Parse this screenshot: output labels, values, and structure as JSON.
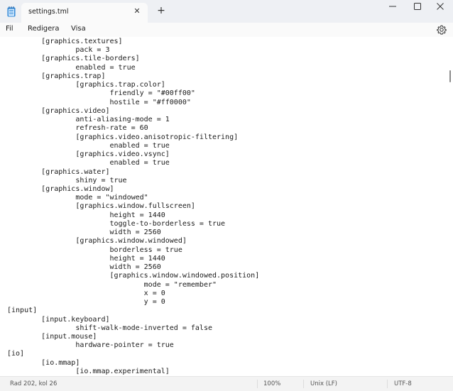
{
  "window": {
    "tab_title": "settings.tml",
    "tab_close": "✕",
    "new_tab": "+"
  },
  "menu": {
    "items": [
      "Fil",
      "Redigera",
      "Visa"
    ]
  },
  "editor": {
    "lines": [
      "        [graphics.textures]",
      "                pack = 3",
      "        [graphics.tile-borders]",
      "                enabled = true",
      "        [graphics.trap]",
      "                [graphics.trap.color]",
      "                        friendly = \"#00ff00\"",
      "                        hostile = \"#ff0000\"",
      "        [graphics.video]",
      "                anti-aliasing-mode = 1",
      "                refresh-rate = 60",
      "                [graphics.video.anisotropic-filtering]",
      "                        enabled = true",
      "                [graphics.video.vsync]",
      "                        enabled = true",
      "        [graphics.water]",
      "                shiny = true",
      "        [graphics.window]",
      "                mode = \"windowed\"",
      "                [graphics.window.fullscreen]",
      "                        height = 1440",
      "                        toggle-to-borderless = true",
      "                        width = 2560",
      "                [graphics.window.windowed]",
      "                        borderless = true",
      "                        height = 1440",
      "                        width = 2560",
      "                        [graphics.window.windowed.position]",
      "                                mode = \"remember\"",
      "                                x = 0",
      "                                y = 0",
      "[input]",
      "        [input.keyboard]",
      "                shift-walk-mode-inverted = false",
      "        [input.mouse]",
      "                hardware-pointer = true",
      "[io]",
      "        [io.mmap]",
      "                [io.mmap.experimental]"
    ]
  },
  "status": {
    "position": "Rad 202, kol 26",
    "zoom": "100%",
    "line_ending": "Unix (LF)",
    "encoding": "UTF-8"
  }
}
